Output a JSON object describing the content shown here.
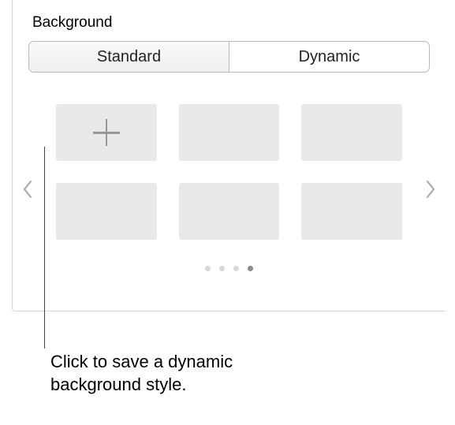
{
  "panel": {
    "heading": "Background"
  },
  "segmented": {
    "standard": "Standard",
    "dynamic": "Dynamic",
    "selected": "dynamic"
  },
  "carousel": {
    "slots": {
      "add": "add-style",
      "empty": [
        "slot-2",
        "slot-3",
        "slot-4",
        "slot-5",
        "slot-6"
      ]
    },
    "pages": {
      "count": 4,
      "active_index": 3
    }
  },
  "callout": {
    "text": "Click to save a dynamic background style."
  }
}
